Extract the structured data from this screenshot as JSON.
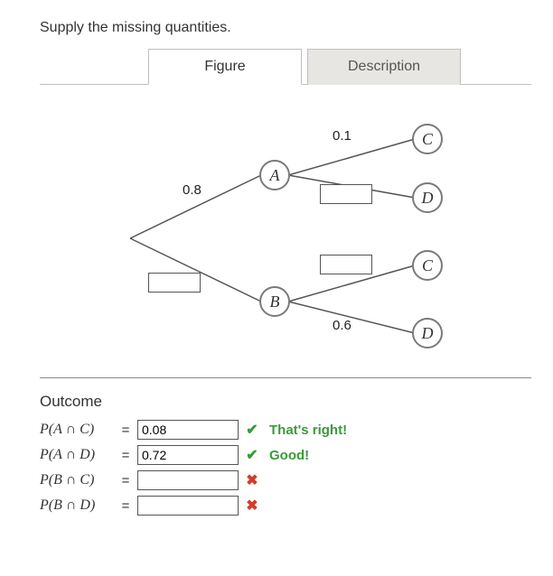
{
  "prompt": "Supply the missing quantities.",
  "tabs": {
    "figure": "Figure",
    "description": "Description"
  },
  "tree": {
    "nodes": {
      "A": "A",
      "B": "B",
      "C1": "C",
      "D1": "D",
      "C2": "C",
      "D2": "D"
    },
    "edge_labels": {
      "rootA": "0.8",
      "AC": "0.1",
      "BD": "0.6"
    },
    "edge_inputs": {
      "rootB": "",
      "AD": "",
      "BC": ""
    }
  },
  "outcome_heading": "Outcome",
  "outcomes": [
    {
      "label": "P(A ∩ C)",
      "value": "0.08",
      "status": "correct",
      "feedback": "That's right!"
    },
    {
      "label": "P(A ∩ D)",
      "value": "0.72",
      "status": "correct",
      "feedback": "Good!"
    },
    {
      "label": "P(B ∩ C)",
      "value": "",
      "status": "wrong",
      "feedback": ""
    },
    {
      "label": "P(B ∩ D)",
      "value": "",
      "status": "wrong",
      "feedback": ""
    }
  ],
  "equals": "="
}
